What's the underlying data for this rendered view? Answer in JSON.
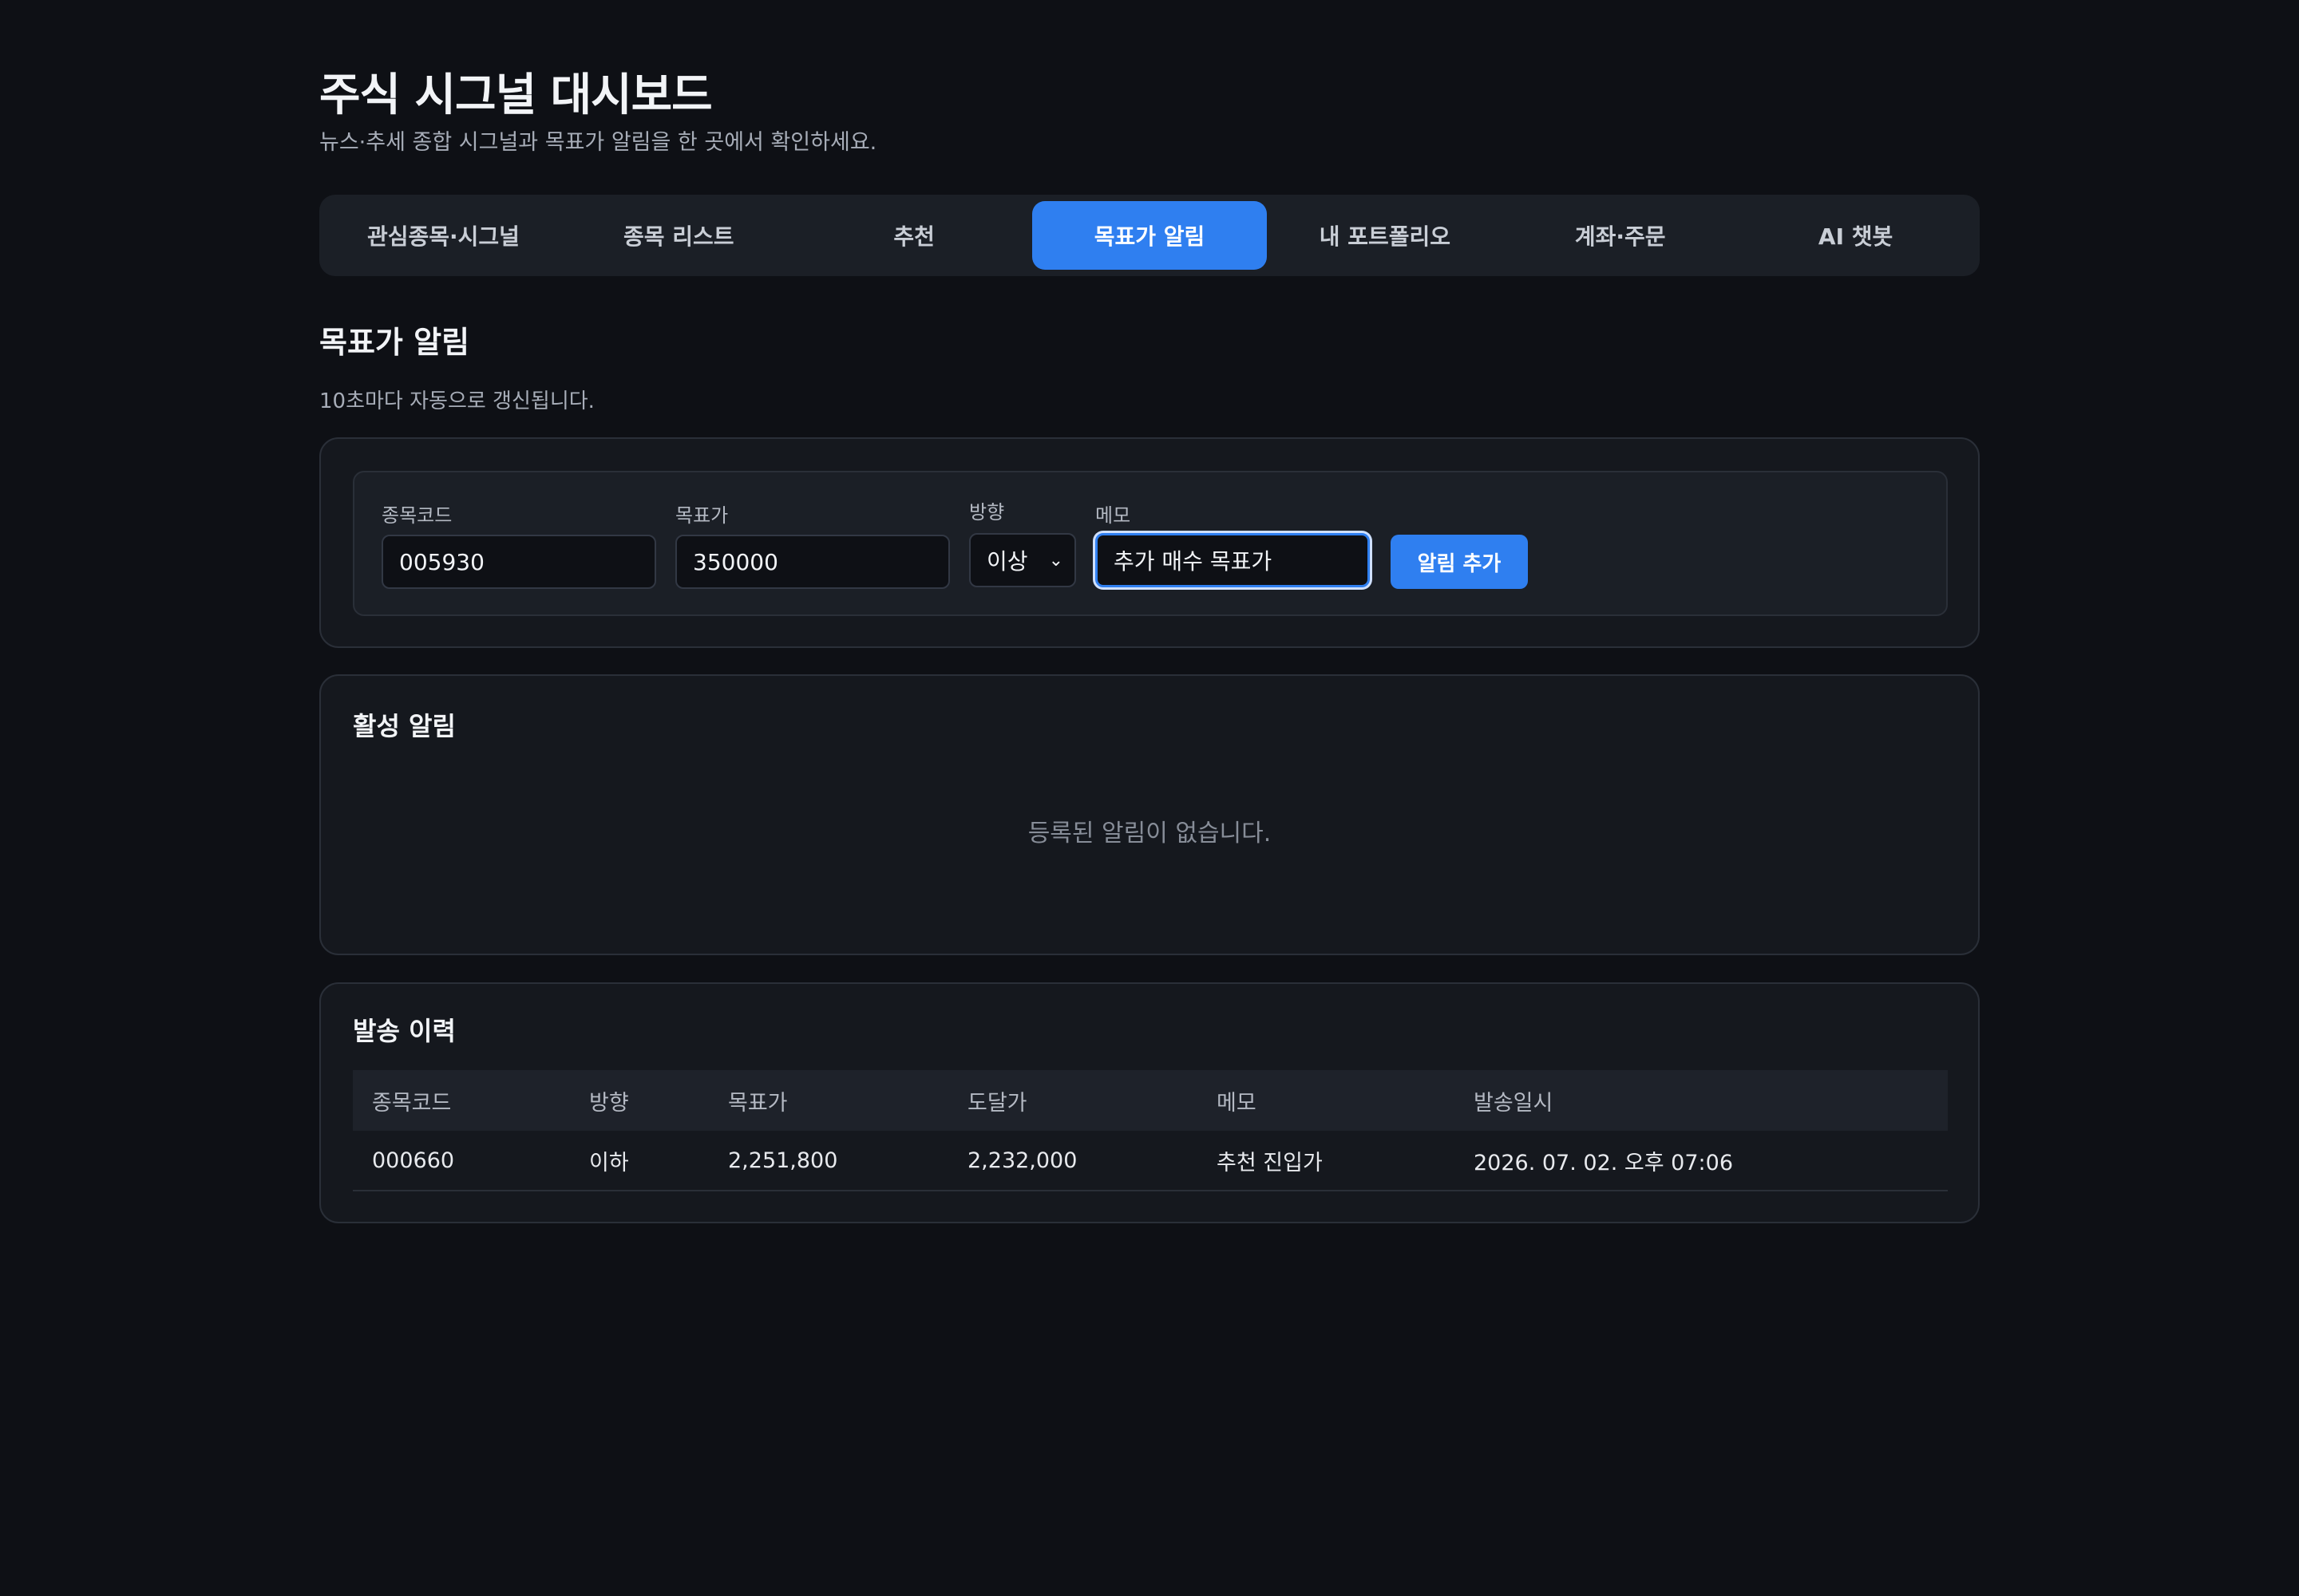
{
  "header": {
    "title": "주식 시그널 대시보드",
    "subtitle": "뉴스·추세 종합 시그널과 목표가 알림을 한 곳에서 확인하세요."
  },
  "tabs": [
    {
      "label": "관심종목·시그널",
      "active": false
    },
    {
      "label": "종목 리스트",
      "active": false
    },
    {
      "label": "추천",
      "active": false
    },
    {
      "label": "목표가 알림",
      "active": true
    },
    {
      "label": "내 포트폴리오",
      "active": false
    },
    {
      "label": "계좌·주문",
      "active": false
    },
    {
      "label": "AI 챗봇",
      "active": false
    }
  ],
  "section": {
    "title": "목표가 알림",
    "note": "10초마다 자동으로 갱신됩니다."
  },
  "form": {
    "code_label": "종목코드",
    "code_value": "005930",
    "price_label": "목표가",
    "price_value": "350000",
    "direction_label": "방향",
    "direction_value": "이상",
    "memo_label": "메모",
    "memo_value": "추가 매수 목표가",
    "add_button": "알림 추가"
  },
  "active_alerts": {
    "title": "활성 알림",
    "empty_message": "등록된 알림이 없습니다."
  },
  "history": {
    "title": "발송 이력",
    "columns": [
      "종목코드",
      "방향",
      "목표가",
      "도달가",
      "메모",
      "발송일시"
    ],
    "rows": [
      [
        "000660",
        "이하",
        "2,251,800",
        "2,232,000",
        "추천 진입가",
        "2026. 07. 02. 오후 07:06"
      ]
    ]
  },
  "colors": {
    "background": "#0e1015",
    "accent": "#2f7ff0",
    "card": "#15181e"
  }
}
